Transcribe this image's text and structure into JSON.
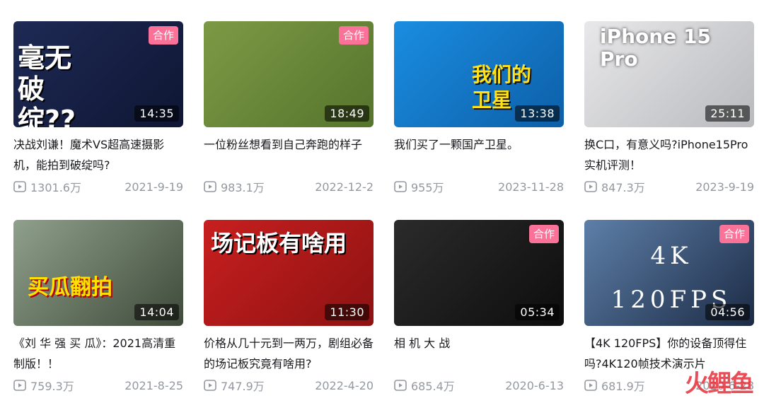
{
  "videos": [
    {
      "title": "决战刘谦！魔术VS超高速摄影机，能拍到破绽吗?",
      "views": "1301.6万",
      "date": "2021-9-19",
      "duration": "14:35",
      "badge": "合作",
      "thumb_text": "毫无破绽??",
      "colors": [
        "#1e2a55",
        "#0f1633"
      ]
    },
    {
      "title": "一位粉丝想看到自己奔跑的样子",
      "views": "983.1万",
      "date": "2022-12-2",
      "duration": "18:49",
      "badge": "合作",
      "thumb_text": "",
      "colors": [
        "#7c9a45",
        "#56742c"
      ]
    },
    {
      "title": "我们买了一颗国产卫星。",
      "views": "955万",
      "date": "2023-11-28",
      "duration": "13:38",
      "badge": "",
      "thumb_text": "我们的卫星",
      "colors": [
        "#1a8de0",
        "#0d5fa8"
      ]
    },
    {
      "title": "换C口，有意义吗?iPhone15Pro实机评测！",
      "views": "847.3万",
      "date": "2023-9-19",
      "duration": "25:11",
      "badge": "",
      "thumb_text": "iPhone 15 Pro",
      "colors": [
        "#e8e8ea",
        "#b9babd"
      ]
    },
    {
      "title": "《刘 华 强 买 瓜》：2021高清重制版！！",
      "views": "759.3万",
      "date": "2021-8-25",
      "duration": "14:04",
      "badge": "",
      "thumb_text": "买瓜翻拍",
      "colors": [
        "#8fa08c",
        "#3f4a3a"
      ]
    },
    {
      "title": "价格从几十元到一两万，剧组必备的场记板究竟有啥用?",
      "views": "747.9万",
      "date": "2022-4-20",
      "duration": "11:30",
      "badge": "",
      "thumb_text": "场记板有啥用",
      "colors": [
        "#c81f1f",
        "#8e1212"
      ]
    },
    {
      "title": "相 机 大 战",
      "views": "685.4万",
      "date": "2020-6-13",
      "duration": "05:34",
      "badge": "合作",
      "thumb_text": "",
      "colors": [
        "#2b2b2b",
        "#0d0d0d"
      ]
    },
    {
      "title": "【4K 120FPS】你的设备顶得住吗?4K120帧技术演示片",
      "views": "681.9万",
      "date": "2020-6-28",
      "duration": "04:56",
      "badge": "合作",
      "thumb_text": "4K 120FPS",
      "colors": [
        "#5d7fa8",
        "#1c2b45"
      ]
    }
  ],
  "watermark": "火鲤鱼",
  "icons": {
    "play": "play-count-icon"
  }
}
